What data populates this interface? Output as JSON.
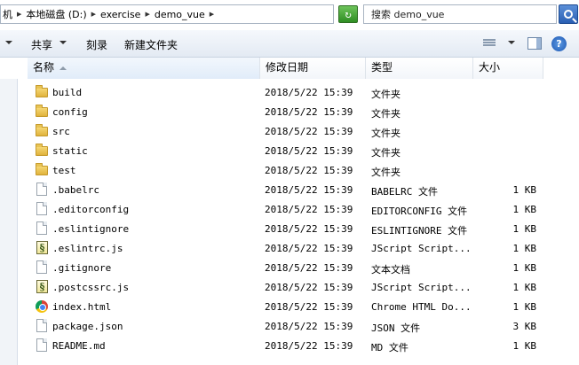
{
  "address": {
    "segments": [
      "机",
      "本地磁盘 (D:)",
      "exercise",
      "demo_vue"
    ],
    "search_placeholder": "搜索 demo_vue"
  },
  "toolbar": {
    "share_label": "共享",
    "burn_label": "刻录",
    "new_folder_label": "新建文件夹"
  },
  "columns": {
    "name": "名称",
    "date": "修改日期",
    "type": "类型",
    "size": "大小"
  },
  "files": [
    {
      "name": "build",
      "date": "2018/5/22 15:39",
      "type": "文件夹",
      "size": "",
      "icon": "folder-icon"
    },
    {
      "name": "config",
      "date": "2018/5/22 15:39",
      "type": "文件夹",
      "size": "",
      "icon": "folder-icon"
    },
    {
      "name": "src",
      "date": "2018/5/22 15:39",
      "type": "文件夹",
      "size": "",
      "icon": "folder-icon"
    },
    {
      "name": "static",
      "date": "2018/5/22 15:39",
      "type": "文件夹",
      "size": "",
      "icon": "folder-icon"
    },
    {
      "name": "test",
      "date": "2018/5/22 15:39",
      "type": "文件夹",
      "size": "",
      "icon": "folder-icon"
    },
    {
      "name": ".babelrc",
      "date": "2018/5/22 15:39",
      "type": "BABELRC 文件",
      "size": "1 KB",
      "icon": "file-icon"
    },
    {
      "name": ".editorconfig",
      "date": "2018/5/22 15:39",
      "type": "EDITORCONFIG 文件",
      "size": "1 KB",
      "icon": "file-icon"
    },
    {
      "name": ".eslintignore",
      "date": "2018/5/22 15:39",
      "type": "ESLINTIGNORE 文件",
      "size": "1 KB",
      "icon": "file-icon"
    },
    {
      "name": ".eslintrc.js",
      "date": "2018/5/22 15:39",
      "type": "JScript Script...",
      "size": "1 KB",
      "icon": "js-script-icon"
    },
    {
      "name": ".gitignore",
      "date": "2018/5/22 15:39",
      "type": "文本文档",
      "size": "1 KB",
      "icon": "file-icon"
    },
    {
      "name": ".postcssrc.js",
      "date": "2018/5/22 15:39",
      "type": "JScript Script...",
      "size": "1 KB",
      "icon": "js-script-icon"
    },
    {
      "name": "index.html",
      "date": "2018/5/22 15:39",
      "type": "Chrome HTML Do...",
      "size": "1 KB",
      "icon": "chrome-html-icon"
    },
    {
      "name": "package.json",
      "date": "2018/5/22 15:39",
      "type": "JSON 文件",
      "size": "3 KB",
      "icon": "file-icon"
    },
    {
      "name": "README.md",
      "date": "2018/5/22 15:39",
      "type": "MD 文件",
      "size": "1 KB",
      "icon": "file-icon"
    }
  ]
}
